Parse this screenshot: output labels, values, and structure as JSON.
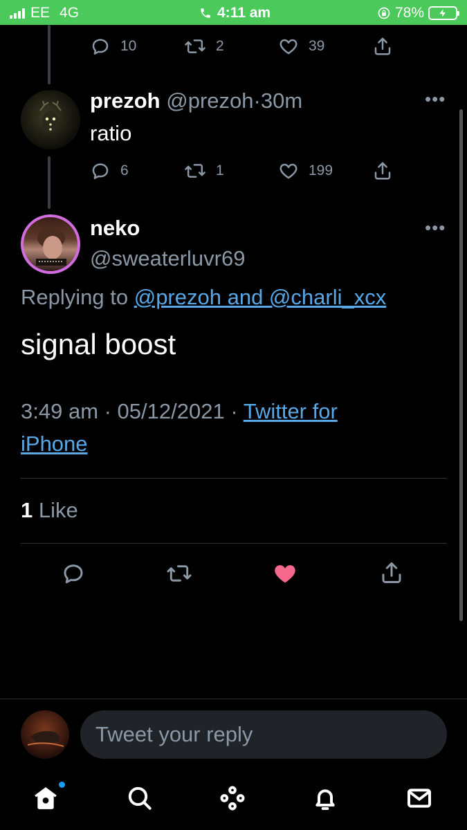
{
  "status_bar": {
    "carrier": "EE",
    "network": "4G",
    "time": "4:11 am",
    "battery": "78%"
  },
  "prev_tweet": {
    "replies": "10",
    "retweets": "2",
    "likes": "39"
  },
  "prezoh_tweet": {
    "name": "prezoh",
    "handle": "@prezoh",
    "separator": "·",
    "time": "30m",
    "text": "ratio",
    "replies": "6",
    "retweets": "1",
    "likes": "199"
  },
  "main_tweet": {
    "name": "neko",
    "handle": "@sweaterluvr69",
    "replying_prefix": "Replying to",
    "replying_to": "@prezoh and @charli_xcx",
    "text": "signal boost",
    "timestamp": "3:49 am · 05/12/2021 ·",
    "source_part1": "Twitter for",
    "source_part2": "iPhone",
    "like_count": "1",
    "like_label": "Like",
    "liked_color": "#f7688f"
  },
  "reply_box": {
    "placeholder": "Tweet your reply"
  },
  "tabbar": {
    "items": [
      "home-tab",
      "search-tab",
      "spaces-tab",
      "notifications-tab",
      "messages-tab"
    ],
    "notification_dot_color": "#1d9bf0"
  },
  "colors": {
    "status_bar_bg": "#4bc95b",
    "link": "#58a8e8",
    "secondary_text": "#8b98a5"
  }
}
